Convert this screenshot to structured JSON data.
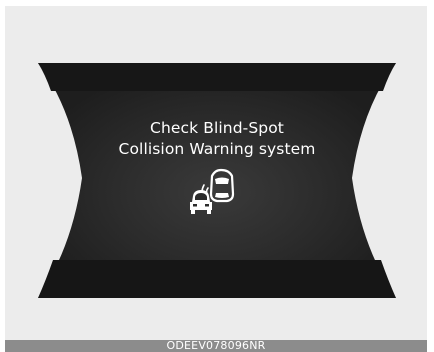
{
  "cluster_display": {
    "message_line_1": "Check Blind-Spot",
    "message_line_2": "Collision Warning system",
    "icon": "blind-spot-collision-warning-icon",
    "colors": {
      "background": "#ececec",
      "panel": "#232323",
      "text": "#ffffff",
      "caption_bar": "#8c8c8c"
    }
  },
  "caption": {
    "code": "ODEEV078096NR"
  }
}
